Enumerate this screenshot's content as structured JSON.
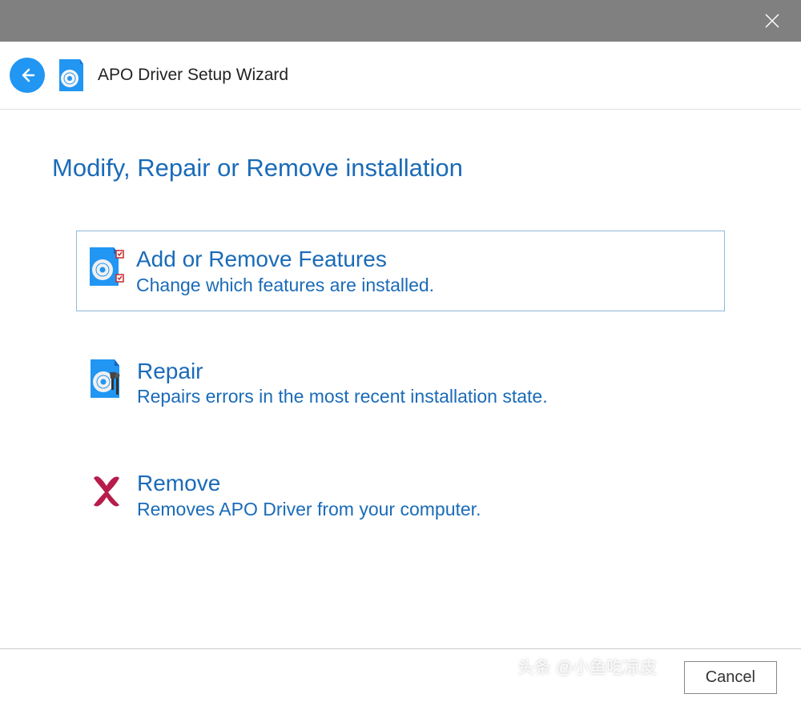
{
  "header": {
    "title": "APO Driver Setup Wizard"
  },
  "page": {
    "title": "Modify, Repair or Remove installation"
  },
  "options": {
    "add_remove": {
      "title": "Add or Remove Features",
      "desc": "Change which features are installed."
    },
    "repair": {
      "title": "Repair",
      "desc": "Repairs errors in the most recent installation state."
    },
    "remove": {
      "title": "Remove",
      "desc": "Removes APO Driver from your computer."
    }
  },
  "footer": {
    "cancel": "Cancel"
  },
  "watermark": "头条 @小鱼吃凉皮"
}
